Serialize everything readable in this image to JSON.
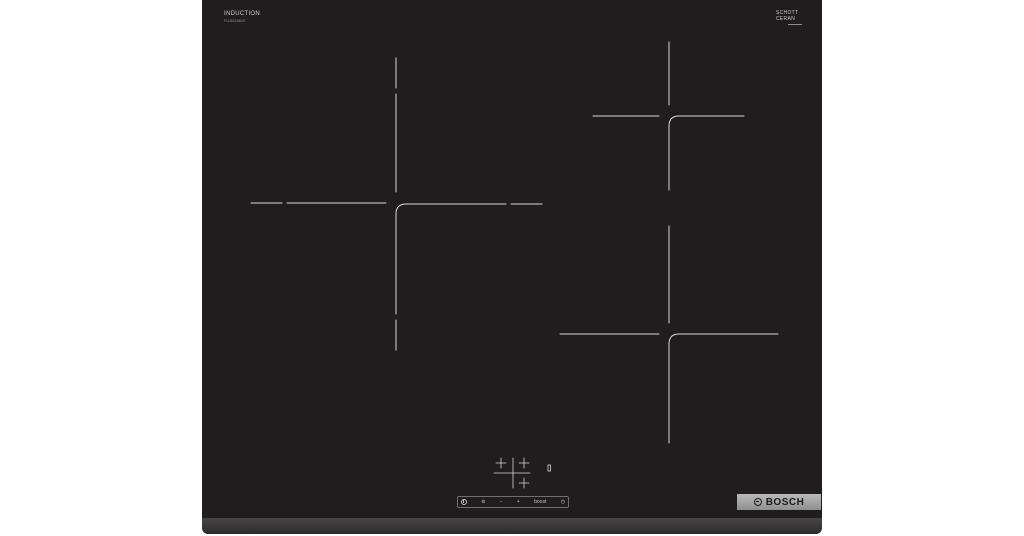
{
  "product": {
    "top_left_label": "INDUCTION",
    "top_left_model": "PUJ631BB2E",
    "top_right_label_line1": "SCHOTT",
    "top_right_label_line2": "CERAN",
    "brand": "BOSCH"
  },
  "controls": {
    "labels": [
      "",
      "",
      "−",
      "+",
      "boost",
      ""
    ],
    "zone_selector_icons": [
      "plus-marks",
      "zone-indicator"
    ]
  },
  "colors": {
    "glass": "#1f1d1d",
    "marking": "#d8d8d8",
    "frame": "#3a3939",
    "logo_plate": "#a5a5a5"
  }
}
